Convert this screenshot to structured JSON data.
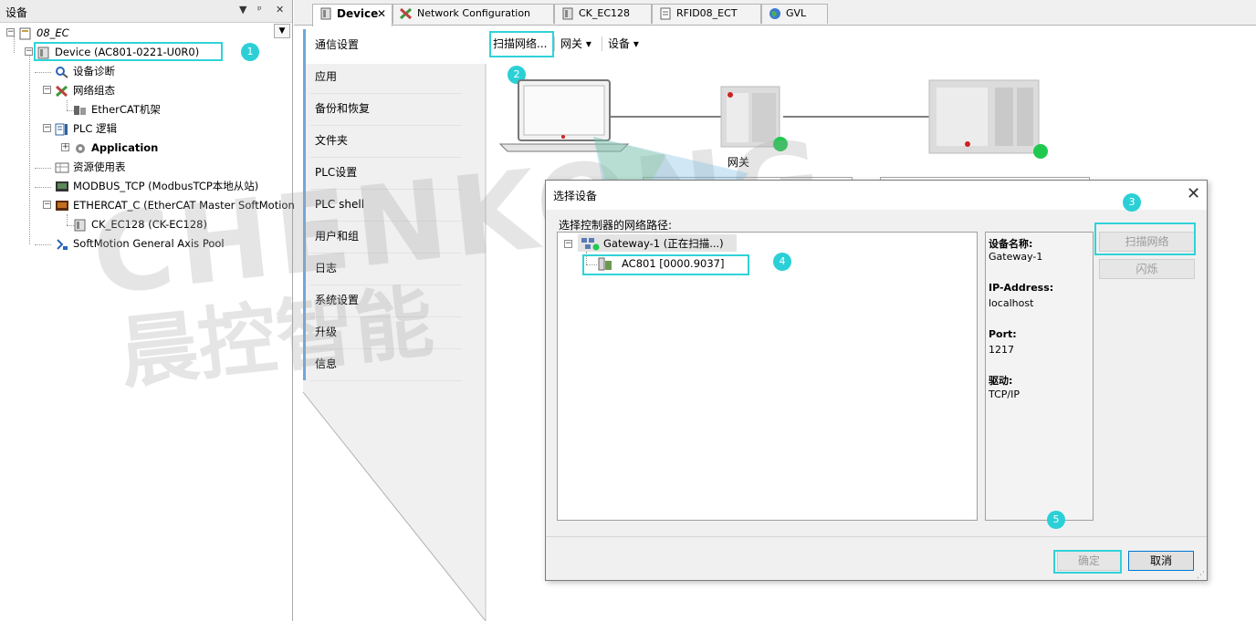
{
  "left_panel": {
    "title": "设备",
    "pin_glyph": "▼  ᵖ  ✕",
    "tree": [
      {
        "label": "08_EC",
        "italic": true
      },
      {
        "label": "Device (AC801-0221-U0R0)"
      },
      {
        "label": "设备诊断"
      },
      {
        "label": "网络组态"
      },
      {
        "label": "EtherCAT机架"
      },
      {
        "label": "PLC 逻辑"
      },
      {
        "label": "Application",
        "bold": true
      },
      {
        "label": "资源使用表"
      },
      {
        "label": "MODBUS_TCP (ModbusTCP本地从站)"
      },
      {
        "label": "ETHERCAT_C (EtherCAT Master SoftMotion)"
      },
      {
        "label": "CK_EC128 (CK-EC128)"
      },
      {
        "label": "SoftMotion General Axis Pool"
      }
    ]
  },
  "badges": [
    "1",
    "2",
    "3",
    "4",
    "5"
  ],
  "tabs": [
    {
      "label": "Device",
      "close": "✕"
    },
    {
      "label": "Network Configuration"
    },
    {
      "label": "CK_EC128"
    },
    {
      "label": "RFID08_ECT"
    },
    {
      "label": "GVL"
    }
  ],
  "nav": [
    "通信设置",
    "应用",
    "备份和恢复",
    "文件夹",
    "PLC设置",
    "PLC shell",
    "用户和组",
    "日志",
    "系统设置",
    "升级",
    "信息"
  ],
  "menu": {
    "scan": "扫描网络...",
    "gateway": "网关 ▾",
    "device": "设备 ▾"
  },
  "network": {
    "gateway_label": "网关"
  },
  "dialog": {
    "title": "选择设备",
    "close": "✕",
    "path_label": "选择控制器的网络路径:",
    "tree_gateway": "Gateway-1 (正在扫描...)",
    "tree_device": "AC801 [0000.9037]",
    "info": [
      {
        "label": "设备名称:",
        "value": "Gateway-1"
      },
      {
        "label": "IP-Address:",
        "value": "localhost"
      },
      {
        "label": "Port:",
        "value": "1217"
      },
      {
        "label": "驱动:",
        "value": "TCP/IP"
      }
    ],
    "btn_scan": "扫描网络",
    "btn_blink": "闪烁",
    "btn_ok": "确定",
    "btn_cancel": "取消"
  },
  "watermark": {
    "latin": "CHENKONG",
    "cjk": "晨控智能"
  },
  "colors": {
    "highlight": "#2fd3d8",
    "status_green": "#1fc94f",
    "nav_border": "#6fa8dc"
  }
}
